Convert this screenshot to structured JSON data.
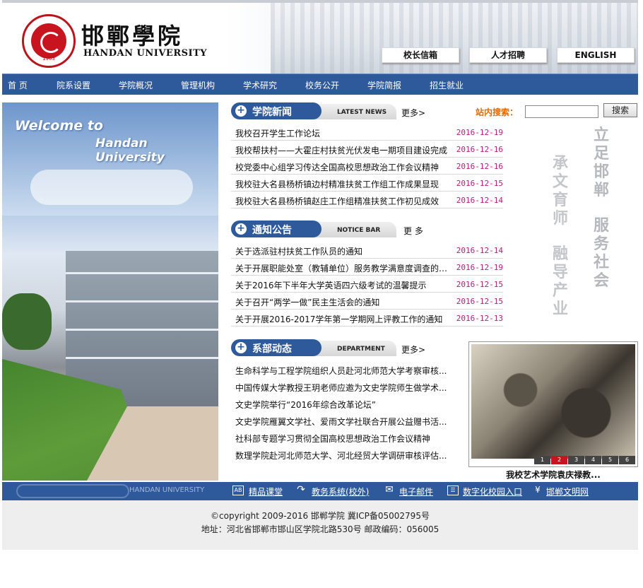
{
  "header": {
    "logo_cn": "邯鄲學院",
    "logo_en": "HANDAN UNIVERSITY",
    "seal_year": "1903",
    "buttons": [
      "校长信箱",
      "人才招聘",
      "ENGLISH"
    ]
  },
  "nav": [
    "首 页",
    "院系设置",
    "学院概况",
    "管理机构",
    "学术研究",
    "校务公开",
    "学院简报",
    "招生就业"
  ],
  "photo": {
    "line1": "Welcome to",
    "line2": "Handan University"
  },
  "news": {
    "title": "学院新闻",
    "tab": "LATEST NEWS",
    "more": "更多>",
    "items": [
      {
        "text": "我校召开学生工作论坛",
        "date": "2016-12-19"
      },
      {
        "text": "我校帮扶村——大霍庄村扶贫光伏发电一期项目建设完成",
        "date": "2016-12-16"
      },
      {
        "text": "校党委中心组学习传达全国高校思想政治工作会议精神",
        "date": "2016-12-16"
      },
      {
        "text": "我校驻大名县杨桥镇边村精准扶贫工作组工作成果显现",
        "date": "2016-12-15"
      },
      {
        "text": "我校驻大名县杨桥镇赵庄工作组精准扶贫工作初见成效",
        "date": "2016-12-14"
      }
    ]
  },
  "notice": {
    "title": "通知公告",
    "tab": "NOTICE BAR",
    "more": "更 多",
    "items": [
      {
        "text": "关于选派驻村扶贫工作队员的通知",
        "date": "2016-12-14"
      },
      {
        "text": "关于开展职能处室（教辅单位）服务教学满意度调查的通知",
        "date": "2016-12-19"
      },
      {
        "text": "关于2016年下半年大学英语四六级考试的温馨提示",
        "date": "2016-12-15"
      },
      {
        "text": "关于召开“两学一做”民主生活会的通知",
        "date": "2016-12-15"
      },
      {
        "text": "关于开展2016-2017学年第一学期网上评教工作的通知",
        "date": "2016-12-13"
      }
    ]
  },
  "dept": {
    "title": "系部动态",
    "tab": "DEPARTMENT",
    "more": "更多>",
    "items": [
      "生命科学与工程学院组织人员赴河北师范大学考察审核...",
      "中国传媒大学教授王玥老师应邀为文史学院师生做学术...",
      "文史学院举行“2016年综合改革论坛”",
      "文史学院雁翼文学社、爱雨文学社联合开展公益赠书活...",
      "社科部专题学习贯彻全国高校思想政治工作会议精神",
      "数理学院赴河北师范大学、河北经贸大学调研审核评估..."
    ]
  },
  "search": {
    "label": "站内搜索：",
    "button": "搜索",
    "value": ""
  },
  "motto": {
    "col1": "立足邯郸",
    "col1b": "服务社会",
    "col2": "承文育师",
    "col2b": "融导产业"
  },
  "gallery": {
    "caption": "我校艺术学院袁庆禄教...",
    "pages": [
      "1",
      "2",
      "3",
      "4",
      "5",
      "6"
    ],
    "active": "2"
  },
  "linkbar": {
    "brand": "HANDAN UNIVERSITY",
    "links": [
      "精品课堂",
      "教务系统(校外)",
      "电子邮件",
      "数字化校园入口",
      "邯郸文明网"
    ]
  },
  "footer": {
    "line1": "©copyright 2009-2016   邯郸学院   冀ICP备05002795号",
    "line2": "地址：河北省邯郸市邯山区学院北路530号   邮政编码：056005"
  },
  "colors": {
    "nav_blue": "#2e5a9c",
    "date": "#b0227a",
    "search_label": "#e06a00"
  }
}
